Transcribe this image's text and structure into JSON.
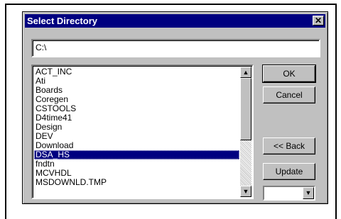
{
  "dialog": {
    "title": "Select Directory",
    "close_icon": "close-icon"
  },
  "path": {
    "value": "C:\\"
  },
  "directories": [
    {
      "label": "ACT_INC"
    },
    {
      "label": "Ati"
    },
    {
      "label": "Boards"
    },
    {
      "label": "Coregen"
    },
    {
      "label": "CSTOOLS"
    },
    {
      "label": "D4time41"
    },
    {
      "label": "Design"
    },
    {
      "label": "DEV"
    },
    {
      "label": "Download"
    },
    {
      "label": "DSA_HS",
      "selected": true
    },
    {
      "label": "fndtn"
    },
    {
      "label": "MCVHDL"
    },
    {
      "label": "MSDOWNLD.TMP"
    }
  ],
  "buttons": {
    "ok": "OK",
    "cancel": "Cancel",
    "back": "<< Back",
    "update": "Update"
  },
  "icons": {
    "scroll_up": "arrow-up-icon",
    "scroll_down": "arrow-down-icon",
    "combo": "chevron-down-icon"
  },
  "colors": {
    "titlebar": "#000080",
    "selection": "#000080",
    "face": "#c0c0c0"
  }
}
